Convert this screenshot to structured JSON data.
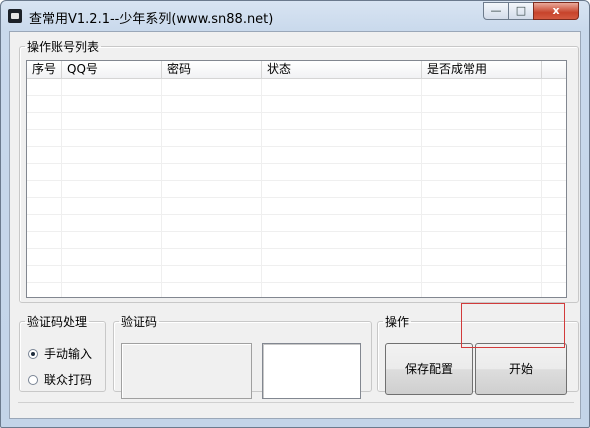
{
  "window": {
    "title": "查常用V1.2.1--少年系列(www.sn88.net)",
    "controls": {
      "minimize": "—",
      "maximize": "□",
      "close": "x"
    }
  },
  "account_list": {
    "legend": "操作账号列表",
    "columns": [
      "序号",
      "QQ号",
      "密码",
      "状态",
      "是否成常用"
    ],
    "rows": []
  },
  "captcha_handling": {
    "legend": "验证码处理",
    "options": [
      {
        "label": "手动输入",
        "selected": true
      },
      {
        "label": "联众打码",
        "selected": false
      }
    ]
  },
  "captcha": {
    "legend": "验证码",
    "input_value": ""
  },
  "operations": {
    "legend": "操作",
    "save_label": "保存配置",
    "start_label": "开始"
  },
  "colors": {
    "window_frame": "#c3d4e8",
    "client_bg": "#f0f0f0",
    "close_button": "#c7432b",
    "highlight_box": "#d23b3b"
  }
}
